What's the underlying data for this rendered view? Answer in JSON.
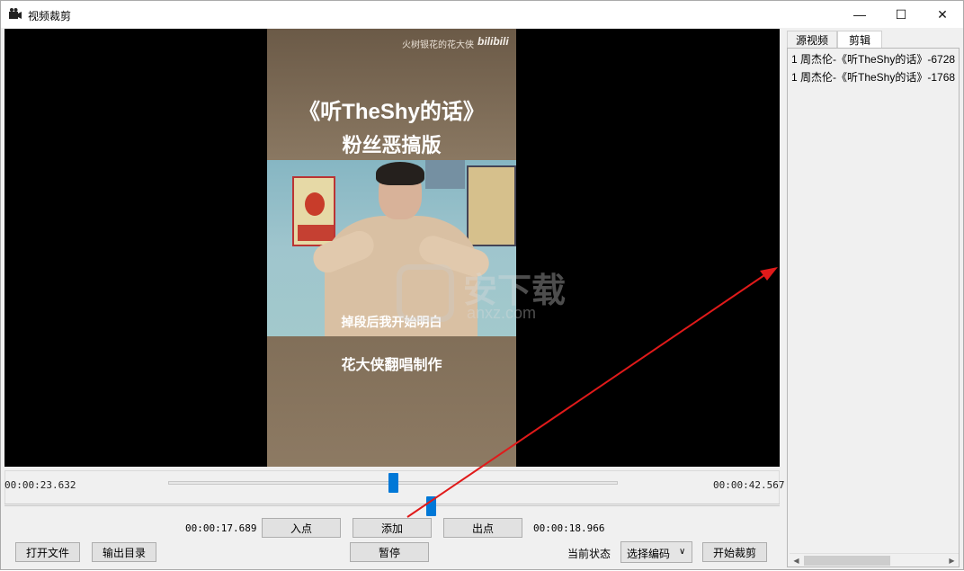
{
  "window": {
    "title": "视频裁剪",
    "minimize": "—",
    "maximize": "☐",
    "close": "✕"
  },
  "video": {
    "overlay_top": "火树银花的花大侠",
    "overlay_brand": "bilibili",
    "title_line1": "《听TheShy的话》",
    "title_line2": "粉丝恶搞版",
    "subtitle": "掉段后我开始明白",
    "credit": "花大侠翻唱制作",
    "watermark_cn": "安下载",
    "watermark_en": "anxz.com"
  },
  "timeline": {
    "current_time": "00:00:23.632",
    "total_time": "00:00:42.567",
    "main_position": 0.5,
    "sub_position": 0.55
  },
  "controls": {
    "in_time": "00:00:17.689",
    "in_point": "入点",
    "add": "添加",
    "out_point": "出点",
    "out_time": "00:00:18.966",
    "open_file": "打开文件",
    "output_dir": "输出目录",
    "pause": "暂停",
    "status_label": "当前状态",
    "encoding_select": "选择编码",
    "start_crop": "开始裁剪"
  },
  "side_panel": {
    "tabs": [
      "源视频",
      "剪辑"
    ],
    "active_tab": "剪辑",
    "items": [
      "1 周杰伦-《听TheShy的话》-6728",
      "1 周杰伦-《听TheShy的话》-1768"
    ]
  },
  "icons": {
    "app": "camera-icon",
    "scroll_left": "chevron-left-icon",
    "scroll_right": "chevron-right-icon",
    "dropdown": "chevron-down-icon"
  },
  "colors": {
    "accent": "#0078d7",
    "annotation_arrow": "#e01a1a"
  }
}
